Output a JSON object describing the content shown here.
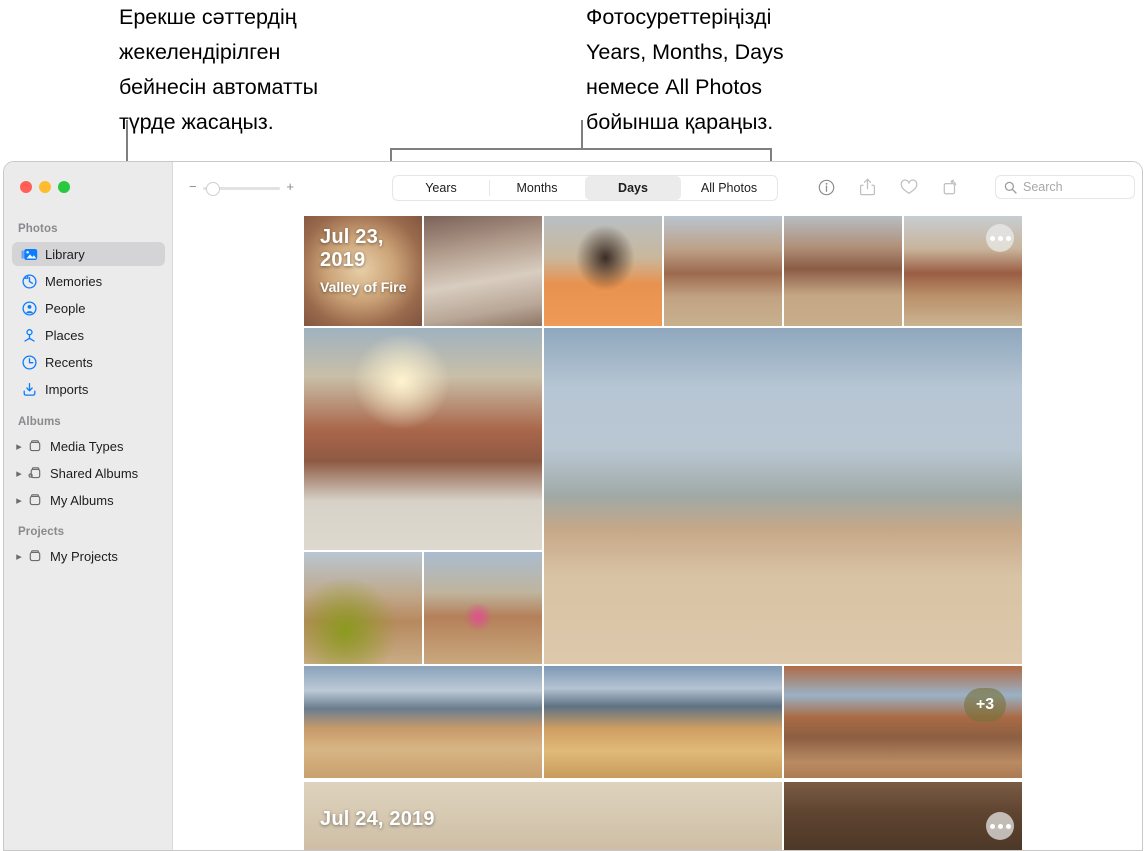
{
  "annotations": {
    "left": "Ерекше сәттердің\nжекелендірілген\nбейнесін автоматты\nтүрде жасаңыз.",
    "right": "Фотосуреттеріңізді\nYears, Months, Days\nнемесе All Photos\nбойынша қараңыз."
  },
  "window": {
    "traffic_lights": [
      "close",
      "minimize",
      "zoom"
    ]
  },
  "sidebar": {
    "sections": [
      {
        "title": "Photos",
        "items": [
          {
            "label": "Library",
            "icon": "library-icon",
            "selected": true
          },
          {
            "label": "Memories",
            "icon": "memories-icon",
            "selected": false
          },
          {
            "label": "People",
            "icon": "people-icon",
            "selected": false
          },
          {
            "label": "Places",
            "icon": "places-icon",
            "selected": false
          },
          {
            "label": "Recents",
            "icon": "recents-icon",
            "selected": false
          },
          {
            "label": "Imports",
            "icon": "imports-icon",
            "selected": false
          }
        ]
      },
      {
        "title": "Albums",
        "items": [
          {
            "label": "Media Types",
            "icon": "album-icon",
            "disclosure": true
          },
          {
            "label": "Shared Albums",
            "icon": "shared-album-icon",
            "disclosure": true
          },
          {
            "label": "My Albums",
            "icon": "album-icon",
            "disclosure": true
          }
        ]
      },
      {
        "title": "Projects",
        "items": [
          {
            "label": "My Projects",
            "icon": "album-icon",
            "disclosure": true
          }
        ]
      }
    ]
  },
  "toolbar": {
    "zoom_slider": {
      "minus": "−",
      "plus": "+",
      "value": 12
    },
    "tabs": [
      {
        "label": "Years",
        "active": false
      },
      {
        "label": "Months",
        "active": false
      },
      {
        "label": "Days",
        "active": true
      },
      {
        "label": "All Photos",
        "active": false
      }
    ],
    "icons": [
      {
        "name": "info-icon"
      },
      {
        "name": "share-icon"
      },
      {
        "name": "favorite-heart-icon"
      },
      {
        "name": "rotate-icon"
      }
    ],
    "search": {
      "placeholder": "Search",
      "value": "",
      "icon": "search-icon"
    }
  },
  "grid": {
    "groups": [
      {
        "date": "Jul 23, 2019",
        "location": "Valley of Fire",
        "more_badge": "more-options-icon",
        "overflow_count": "+3"
      },
      {
        "date": "Jul 24, 2019",
        "location": "",
        "more_badge": "more-options-icon"
      }
    ],
    "photos": [
      {
        "id": "p1",
        "alt": "portrait-blonde-valley"
      },
      {
        "id": "p2",
        "alt": "two-people-on-rock"
      },
      {
        "id": "p3",
        "alt": "portrait-orange-shirt"
      },
      {
        "id": "p4",
        "alt": "person-sitting-orange-outfit"
      },
      {
        "id": "p5",
        "alt": "person-standing-pink-skirt"
      },
      {
        "id": "p6",
        "alt": "person-sitting-on-rock"
      },
      {
        "id": "p7",
        "alt": "sunset-over-valley"
      },
      {
        "id": "p8",
        "alt": "hiker-on-large-sandstone-dome"
      },
      {
        "id": "p9",
        "alt": "woman-green-jacket"
      },
      {
        "id": "p10",
        "alt": "woman-walking-pink-skirt"
      },
      {
        "id": "p11",
        "alt": "person-on-ridge-1"
      },
      {
        "id": "p12",
        "alt": "person-on-ridge-2"
      },
      {
        "id": "p13",
        "alt": "road-through-red-canyon"
      },
      {
        "id": "p14",
        "alt": "bed-blanket"
      },
      {
        "id": "p15",
        "alt": "dark-canyon-wall"
      }
    ]
  },
  "colors": {
    "accent": "#0a7cff",
    "sidebar_bg": "#ebebeb",
    "selected_row": "#d4d4d6",
    "traffic_red": "#ff5f57",
    "traffic_yellow": "#febc2e",
    "traffic_green": "#28c840"
  }
}
